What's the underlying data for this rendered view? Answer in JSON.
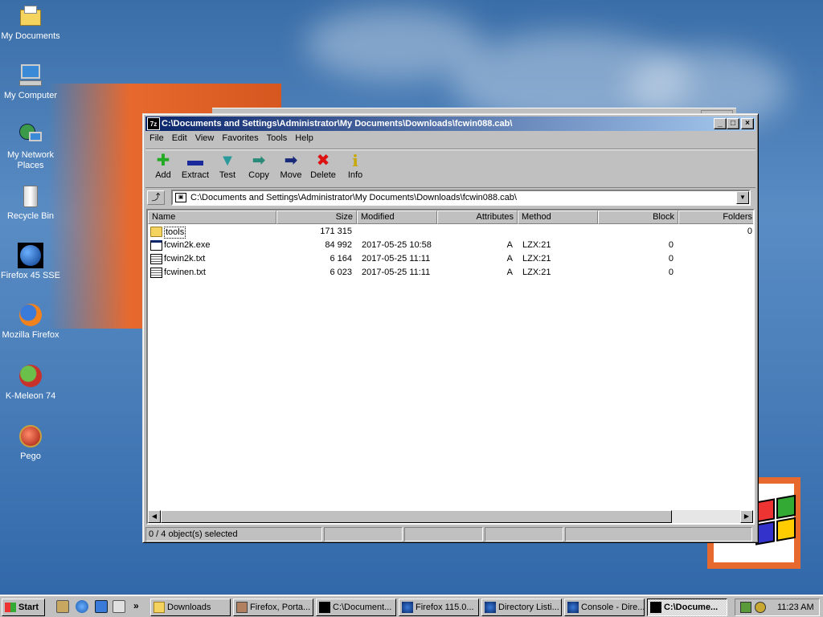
{
  "desktop": {
    "icons": [
      {
        "label": "My Documents"
      },
      {
        "label": "My Computer"
      },
      {
        "label": "My Network Places"
      },
      {
        "label": "Recycle Bin"
      },
      {
        "label": "Firefox 45 SSE"
      },
      {
        "label": "Mozilla Firefox"
      },
      {
        "label": "K-Meleon 74"
      },
      {
        "label": "Pego"
      }
    ]
  },
  "window": {
    "title": "C:\\Documents and Settings\\Administrator\\My Documents\\Downloads\\fcwin088.cab\\",
    "app_icon": "7z",
    "menu": [
      "File",
      "Edit",
      "View",
      "Favorites",
      "Tools",
      "Help"
    ],
    "toolbar": [
      {
        "label": "Add",
        "icon": "plus-icon",
        "color": "#22aa22"
      },
      {
        "label": "Extract",
        "icon": "minus-icon",
        "color": "#1a2a9a"
      },
      {
        "label": "Test",
        "icon": "check-icon",
        "color": "#2a9a9a"
      },
      {
        "label": "Copy",
        "icon": "arrow-right-icon",
        "color": "#2a8a7a"
      },
      {
        "label": "Move",
        "icon": "arrow-right-icon",
        "color": "#1a2a7a"
      },
      {
        "label": "Delete",
        "icon": "x-icon",
        "color": "#dd1111"
      },
      {
        "label": "Info",
        "icon": "info-icon",
        "color": "#c8a800"
      }
    ],
    "address": "C:\\Documents and Settings\\Administrator\\My Documents\\Downloads\\fcwin088.cab\\",
    "columns": [
      "Name",
      "Size",
      "Modified",
      "Attributes",
      "Method",
      "Block",
      "Folders"
    ],
    "rows": [
      {
        "type": "folder",
        "name": "tools",
        "size": "171 315",
        "modified": "",
        "attributes": "",
        "method": "",
        "block": "",
        "folders": "0"
      },
      {
        "type": "exe",
        "name": "fcwin2k.exe",
        "size": "84 992",
        "modified": "2017-05-25 10:58",
        "attributes": "A",
        "method": "LZX:21",
        "block": "0",
        "folders": ""
      },
      {
        "type": "txt",
        "name": "fcwin2k.txt",
        "size": "6 164",
        "modified": "2017-05-25 11:11",
        "attributes": "A",
        "method": "LZX:21",
        "block": "0",
        "folders": ""
      },
      {
        "type": "txt",
        "name": "fcwinen.txt",
        "size": "6 023",
        "modified": "2017-05-25 11:11",
        "attributes": "A",
        "method": "LZX:21",
        "block": "0",
        "folders": ""
      }
    ],
    "status": "0 / 4 object(s) selected"
  },
  "taskbar": {
    "start_label": "Start",
    "tasks": [
      {
        "label": "Downloads",
        "active": false
      },
      {
        "label": "Firefox, Porta...",
        "active": false
      },
      {
        "label": "C:\\Document...",
        "active": false
      },
      {
        "label": "Firefox 115.0...",
        "active": false
      },
      {
        "label": "Directory Listi...",
        "active": false
      },
      {
        "label": "Console - Dire...",
        "active": false
      },
      {
        "label": "C:\\Docume...",
        "active": true
      }
    ],
    "quick_launch_more": "»",
    "clock": "11:23 AM"
  }
}
